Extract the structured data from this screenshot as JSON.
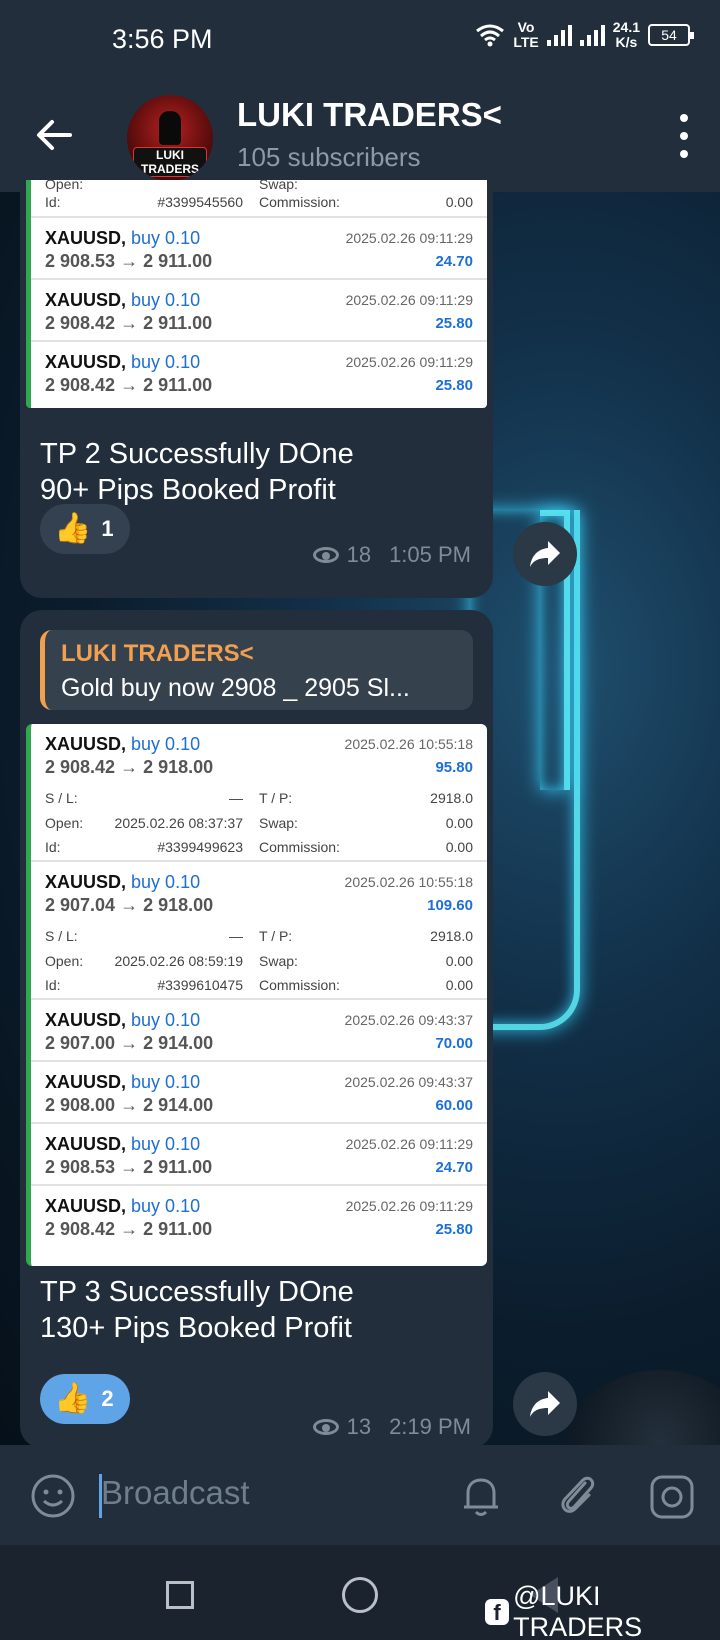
{
  "status_bar": {
    "time": "3:56 PM",
    "network_top": "Vo",
    "network_bottom": "LTE",
    "speed_value": "24.1",
    "speed_unit": "K/s",
    "battery": "54"
  },
  "header": {
    "channel_name": "LUKI TRADERS<",
    "subscribers": "105 subscribers",
    "avatar_text": "LUKI TRADERS"
  },
  "message1": {
    "top_partial": {
      "open_label": "Open:",
      "swap_label": "Swap:",
      "id_label": "Id:",
      "id_value": "#3399545560",
      "commission_label": "Commission:",
      "commission_value": "0.00"
    },
    "trades": [
      {
        "symbol": "XAUUSD,",
        "dir": "buy 0.10",
        "prices": "2 908.53 → 2 911.00",
        "time": "2025.02.26 09:11:29",
        "profit": "24.70"
      },
      {
        "symbol": "XAUUSD,",
        "dir": "buy 0.10",
        "prices": "2 908.42 → 2 911.00",
        "time": "2025.02.26 09:11:29",
        "profit": "25.80"
      },
      {
        "symbol": "XAUUSD,",
        "dir": "buy 0.10",
        "prices": "2 908.42 → 2 911.00",
        "time": "2025.02.26 09:11:29",
        "profit": "25.80"
      }
    ],
    "caption_line1": "TP 2 Successfully DOne",
    "caption_line2": "90+ Pips Booked Profit",
    "reaction_count": "1",
    "views": "18",
    "time": "1:05 PM"
  },
  "message2": {
    "reply_name": "LUKI TRADERS<",
    "reply_text": "Gold buy now 2908 _ 2905  Sl...",
    "trades": [
      {
        "symbol": "XAUUSD,",
        "dir": "buy 0.10",
        "prices": "2 908.42 → 2 918.00",
        "time": "2025.02.26 10:55:18",
        "profit": "95.80",
        "sl_label": "S / L:",
        "sl_value": "—",
        "tp_label": "T / P:",
        "tp_value": "2918.0",
        "open_label": "Open:",
        "open_value": "2025.02.26 08:37:37",
        "swap_label": "Swap:",
        "swap_value": "0.00",
        "id_label": "Id:",
        "id_value": "#3399499623",
        "commission_label": "Commission:",
        "commission_value": "0.00"
      },
      {
        "symbol": "XAUUSD,",
        "dir": "buy 0.10",
        "prices": "2 907.04 → 2 918.00",
        "time": "2025.02.26 10:55:18",
        "profit": "109.60",
        "sl_label": "S / L:",
        "sl_value": "—",
        "tp_label": "T / P:",
        "tp_value": "2918.0",
        "open_label": "Open:",
        "open_value": "2025.02.26 08:59:19",
        "swap_label": "Swap:",
        "swap_value": "0.00",
        "id_label": "Id:",
        "id_value": "#3399610475",
        "commission_label": "Commission:",
        "commission_value": "0.00"
      },
      {
        "symbol": "XAUUSD,",
        "dir": "buy 0.10",
        "prices": "2 907.00 → 2 914.00",
        "time": "2025.02.26 09:43:37",
        "profit": "70.00"
      },
      {
        "symbol": "XAUUSD,",
        "dir": "buy 0.10",
        "prices": "2 908.00 → 2 914.00",
        "time": "2025.02.26 09:43:37",
        "profit": "60.00"
      },
      {
        "symbol": "XAUUSD,",
        "dir": "buy 0.10",
        "prices": "2 908.53 → 2 911.00",
        "time": "2025.02.26 09:11:29",
        "profit": "24.70"
      },
      {
        "symbol": "XAUUSD,",
        "dir": "buy 0.10",
        "prices": "2 908.42 → 2 911.00",
        "time": "2025.02.26 09:11:29",
        "profit": "25.80"
      }
    ],
    "caption_line1": "TP 3 Successfully DOne",
    "caption_line2": "130+ Pips Booked Profit",
    "reaction_count": "2",
    "views": "13",
    "time": "2:19 PM"
  },
  "input_bar": {
    "placeholder": "Broadcast"
  },
  "watermark": {
    "text": "@LUKI TRADERS",
    "fb": "f"
  },
  "colors": {
    "accent": "#5ea4e6",
    "reply_name": "#f0a04e",
    "profit_blue": "#1c6fd8",
    "trade_border": "#2fa84f"
  }
}
